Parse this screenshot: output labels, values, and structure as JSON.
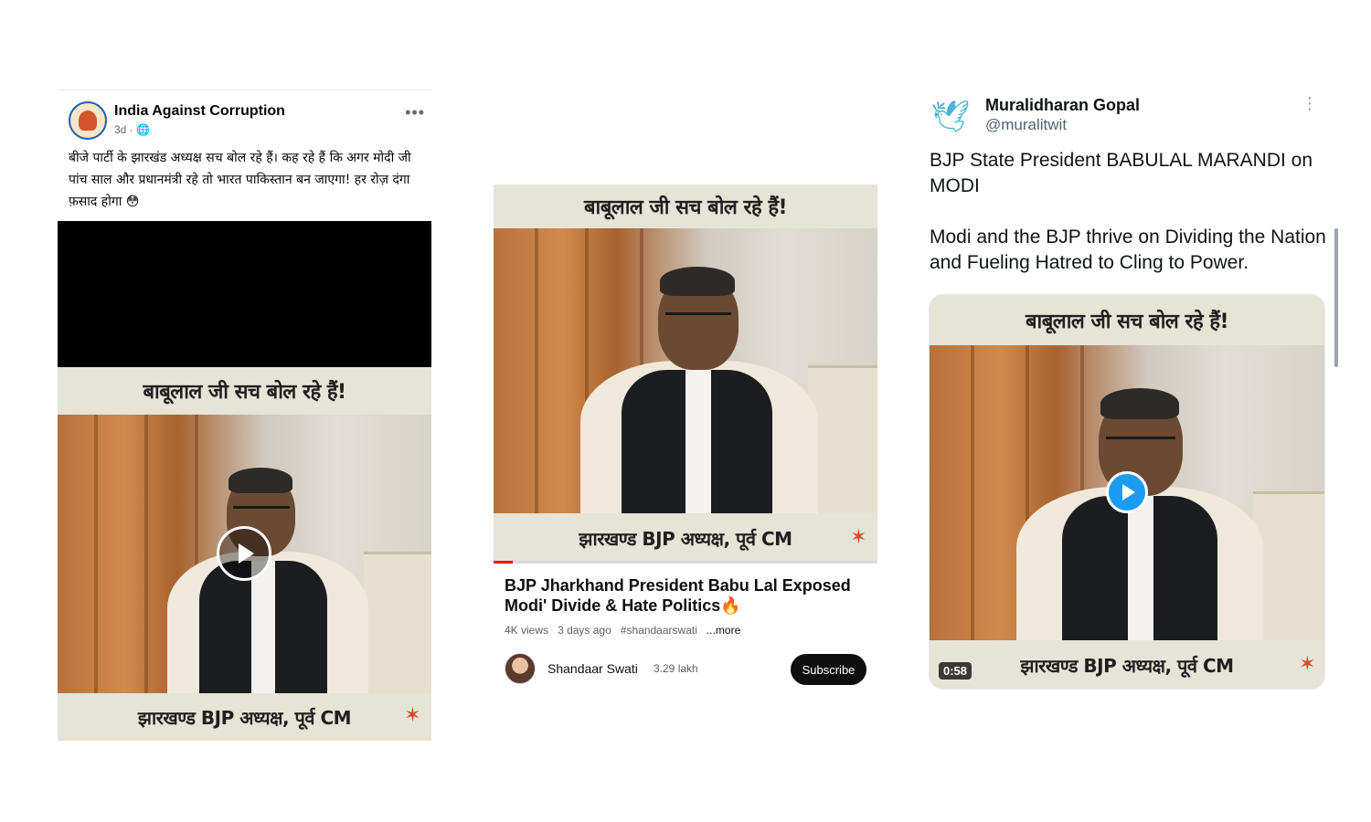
{
  "facebook": {
    "page_name": "India Against Corruption",
    "meta": "3d · 🌐",
    "more_icon": "•••",
    "post_text": "बीजे पार्टी के झारखंड अध्यक्ष सच बोल रहे हैं। कह रहे हैं कि अगर मोदी जी पांच साल और प्रधानमंत्री रहे तो भारत पाकिस्तान बन जाएगा! हर रोज़ दंगा फ़साद होगा 😳",
    "video_banner_top": "बाबूलाल जी सच बोल रहे हैं!",
    "video_banner_bottom": "झारखण्ड BJP अध्यक्ष, पूर्व CM"
  },
  "youtube": {
    "video_banner_top": "बाबूलाल जी सच बोल रहे हैं!",
    "video_banner_bottom": "झारखण्ड BJP अध्यक्ष, पूर्व CM",
    "title": "BJP Jharkhand President Babu Lal Exposed Modi' Divide & Hate Politics🔥",
    "views": "4K views",
    "age": "3 days ago",
    "hashtag": "#shandaarswati",
    "more_label": "...more",
    "channel_name": "Shandaar Swati",
    "subscribers": "3.29 lakh",
    "subscribe_label": "Subscribe",
    "progress_fraction": 0.05,
    "accent": "#ff0000"
  },
  "twitter": {
    "display_name": "Muralidharan Gopal",
    "handle": "@muralitwit",
    "more_icon": "⋮",
    "paragraph1": "BJP State President BABULAL MARANDI on MODI",
    "paragraph2": "Modi and the BJP thrive on Dividing the Nation and Fueling Hatred to Cling to Power.",
    "video_banner_top": "बाबूलाल जी सच बोल रहे हैं!",
    "video_banner_bottom": "झारखण्ड BJP अध्यक्ष, पूर्व CM",
    "duration": "0:58",
    "accent": "#1d9bf0"
  }
}
